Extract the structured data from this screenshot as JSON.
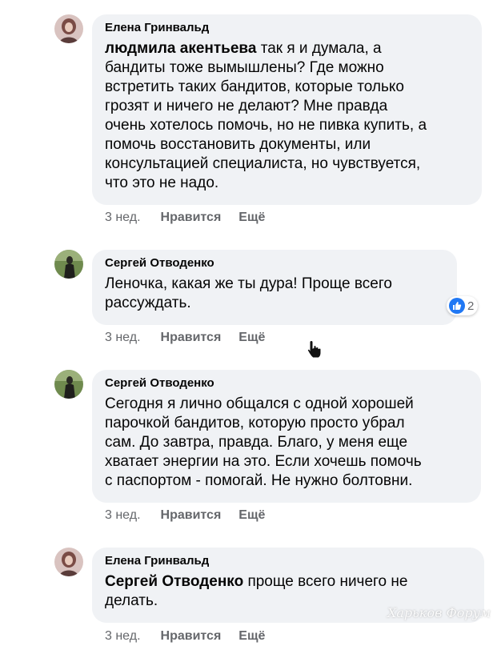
{
  "comments": [
    {
      "author": "Елена Гринвальд",
      "mention": "людмила акентьева",
      "lines": [
        "так я и думала, а",
        "бандиты тоже вымышлены? Где можно",
        "встретить таких бандитов, которые только",
        "грозят и ничего не делают? Мне правда",
        "очень хотелось помочь, но не пивка купить, а",
        "помочь восстановить документы, или",
        "консультацией специалиста, но чувствуется,",
        "что это не надо."
      ],
      "time": "3 нед.",
      "like": "Нравится",
      "more": "Ещё"
    },
    {
      "author": "Сергей Отводенко",
      "lines": [
        "Леночка, какая же ты дура! Проще всего",
        "рассуждать."
      ],
      "reaction_count": "2",
      "time": "3 нед.",
      "like": "Нравится",
      "more": "Ещё"
    },
    {
      "author": "Сергей Отводенко",
      "lines": [
        "Сегодня я лично общался с одной хорошей",
        "парочкой бандитов, которую просто убрал",
        "сам. До завтра, правда. Благо, у меня еще",
        "хватает энергии на это. Если хочешь помочь",
        "с паспортом - помогай. Не нужно болтовни."
      ],
      "time": "3 нед.",
      "like": "Нравится",
      "more": "Ещё"
    },
    {
      "author": "Елена Гринвальд",
      "mention": "Сергей Отводенко",
      "lines": [
        "проще всего ничего не",
        "делать."
      ],
      "time": "3 нед.",
      "like": "Нравится",
      "more": "Ещё"
    }
  ],
  "watermark": "Харьков Форум",
  "colors": {
    "bubble": "#f0f2f5",
    "meta": "#65676b",
    "like_blue": "#2078f4"
  }
}
